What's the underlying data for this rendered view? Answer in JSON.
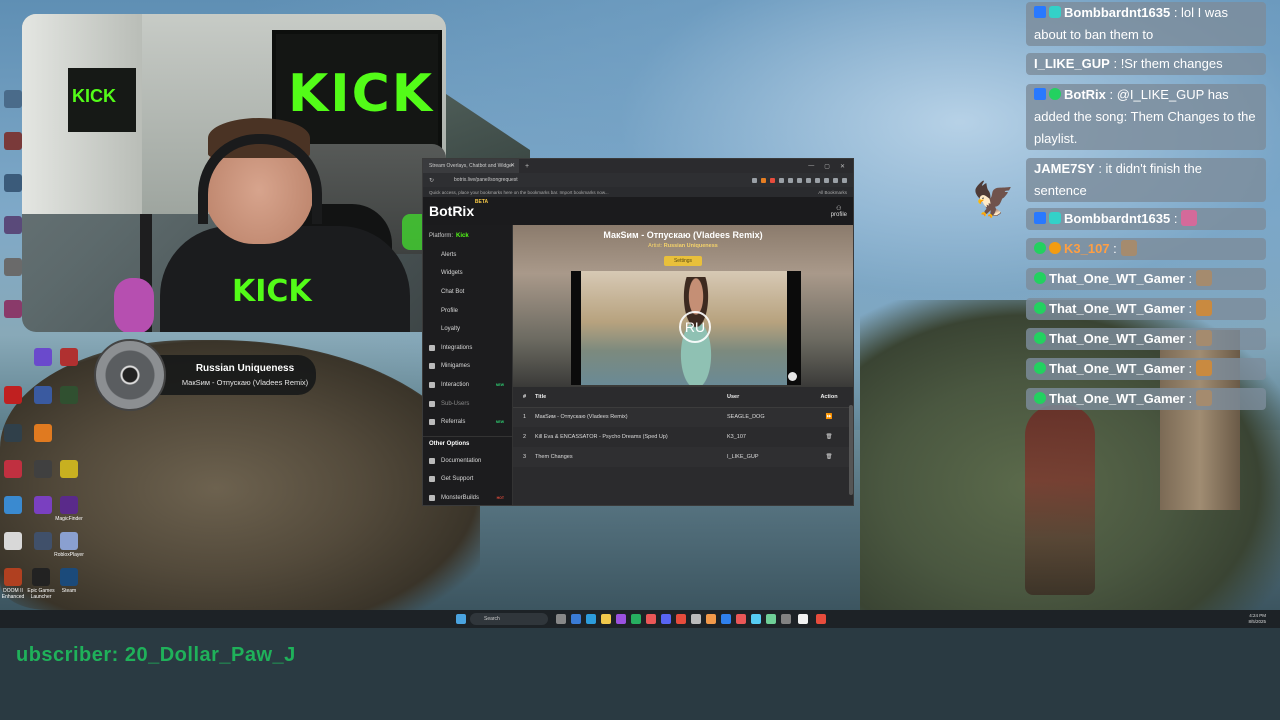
{
  "webcam": {
    "banner_text": "KICK",
    "small_banner_text": "KICK",
    "shirt_text": "KICK"
  },
  "now_playing": {
    "title": "Russian Uniqueness",
    "track": "МакЅим - Отпускаю (Vladees Remix)"
  },
  "browser": {
    "tab_title": "Stream Overlays, Chatbot and Widge",
    "address": "botrix.live/panel/songrequest",
    "bookmark_hint": "Quick access, place your bookmarks here on the bookmarks bar. Import bookmarks now...",
    "all_bookmarks": "All Bookmarks"
  },
  "site": {
    "logo": "BotRix",
    "logo_badge": "BETA",
    "profile": "profile",
    "platform_label": "Platform:",
    "platform_value": "Kick",
    "sidebar_items": [
      {
        "label": "Alerts",
        "badge": ""
      },
      {
        "label": "Widgets",
        "badge": ""
      },
      {
        "label": "Chat Bot",
        "badge": ""
      },
      {
        "label": "Profile",
        "badge": ""
      },
      {
        "label": "Loyalty",
        "badge": ""
      },
      {
        "label": "Integrations",
        "badge": ""
      },
      {
        "label": "Minigames",
        "badge": ""
      },
      {
        "label": "Interaction",
        "badge": "NEW"
      },
      {
        "label": "Sub-Users",
        "badge": ""
      },
      {
        "label": "Referrals",
        "badge": "NEW"
      }
    ],
    "other_heading": "Other Options",
    "other_items": [
      {
        "label": "Documentation",
        "badge": ""
      },
      {
        "label": "Get Support",
        "badge": ""
      },
      {
        "label": "MonsterBuilds",
        "badge": "HOT"
      }
    ],
    "player": {
      "song_title": "МакЅим - Отпускаю (Vladees Remix)",
      "artist_label": "Artist:",
      "artist": "Russian Uniqueness",
      "settings_label": "Settings",
      "video_logo": "RU"
    },
    "queue": {
      "headers": [
        "#",
        "Title",
        "User",
        "Action"
      ],
      "rows": [
        {
          "num": "1",
          "title": "МакЅим - Отпускаю (Vladees Remix)",
          "user": "SEAGLE_DOG",
          "action": "⏩"
        },
        {
          "num": "2",
          "title": "Kill Eva & ENCASSATOR - Psycho Dreams (Sped Up)",
          "user": "K3_107",
          "action": "🗑"
        },
        {
          "num": "3",
          "title": "Them Changes",
          "user": "I_LIKE_GUP",
          "action": "🗑"
        }
      ]
    }
  },
  "chat": [
    {
      "user": "Bombbardnt1635",
      "text": " : lol I was about to ban them to",
      "badges": [
        "blue",
        "cyan"
      ],
      "emote": false
    },
    {
      "user": "I_LIKE_GUP",
      "text": " : !Sr them changes",
      "badges": [],
      "emote": false
    },
    {
      "user": "BotRix",
      "text": " : @I_LIKE_GUP has added the song: Them Changes to the playlist.",
      "badges": [
        "blue",
        "green"
      ],
      "emote": false
    },
    {
      "user": "JAME7SY",
      "text": " : it didn't finish the sentence",
      "badges": [],
      "emote": false
    },
    {
      "user": "Bombbardnt1635",
      "text": " :",
      "badges": [
        "blue",
        "cyan"
      ],
      "emote": true
    },
    {
      "user": "K3_107",
      "text": " :",
      "badges": [
        "green",
        "orange"
      ],
      "emote": true
    },
    {
      "user": "That_One_WT_Gamer",
      "text": " :",
      "badges": [
        "green"
      ],
      "emote": true
    },
    {
      "user": "That_One_WT_Gamer",
      "text": " :",
      "badges": [
        "green"
      ],
      "emote": true
    },
    {
      "user": "That_One_WT_Gamer",
      "text": " :",
      "badges": [
        "green"
      ],
      "emote": true
    },
    {
      "user": "That_One_WT_Gamer",
      "text": " :",
      "badges": [
        "green"
      ],
      "emote": true
    },
    {
      "user": "That_One_WT_Gamer",
      "text": " :",
      "badges": [
        "green"
      ],
      "emote": true
    }
  ],
  "taskbar": {
    "search_placeholder": "Search",
    "time": "4:24 PM",
    "date": "8/5/2025"
  },
  "desktop_icons": [
    {
      "label": "Epic Games Launcher"
    },
    {
      "label": "Steam"
    },
    {
      "label": "DOOM II Enhanced"
    },
    {
      "label": "RobloxPlayer"
    },
    {
      "label": "MagicFinder"
    }
  ],
  "ticker": {
    "text": "ubscriber: 20_Dollar_Paw_J"
  },
  "colors": {
    "kick_green": "#53fc18",
    "settings_yellow": "#e9c03b",
    "chat_bg": "#7d8c9b",
    "ticker_green": "#1fb15a"
  }
}
